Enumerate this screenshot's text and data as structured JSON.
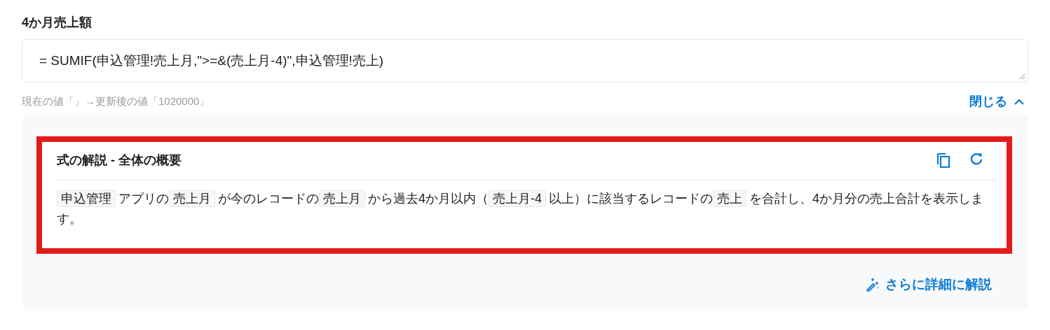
{
  "field": {
    "label": "4か月売上額",
    "value": "= SUMIF(申込管理!売上月,\">=&(売上月-4)\",申込管理!売上)",
    "hint": "現在の値「」→更新後の値「1020000」"
  },
  "toggle": {
    "label": "閉じる",
    "expanded": true
  },
  "explanation": {
    "title": "式の解説 - 全体の概要",
    "highlighted": true,
    "segments": [
      {
        "kind": "code",
        "text": "申込管理"
      },
      {
        "kind": "text",
        "text": "アプリの"
      },
      {
        "kind": "code",
        "text": "売上月"
      },
      {
        "kind": "text",
        "text": "が今のレコードの"
      },
      {
        "kind": "code",
        "text": "売上月"
      },
      {
        "kind": "text",
        "text": "から過去4か月以内（"
      },
      {
        "kind": "code",
        "text": "売上月-4"
      },
      {
        "kind": "text",
        "text": "以上）に該当するレコードの"
      },
      {
        "kind": "code",
        "text": "売上"
      },
      {
        "kind": "text",
        "text": "を合計し、4か月分の売上合計を表示します。"
      }
    ]
  },
  "more_button": {
    "label": "さらに詳細に解説"
  }
}
